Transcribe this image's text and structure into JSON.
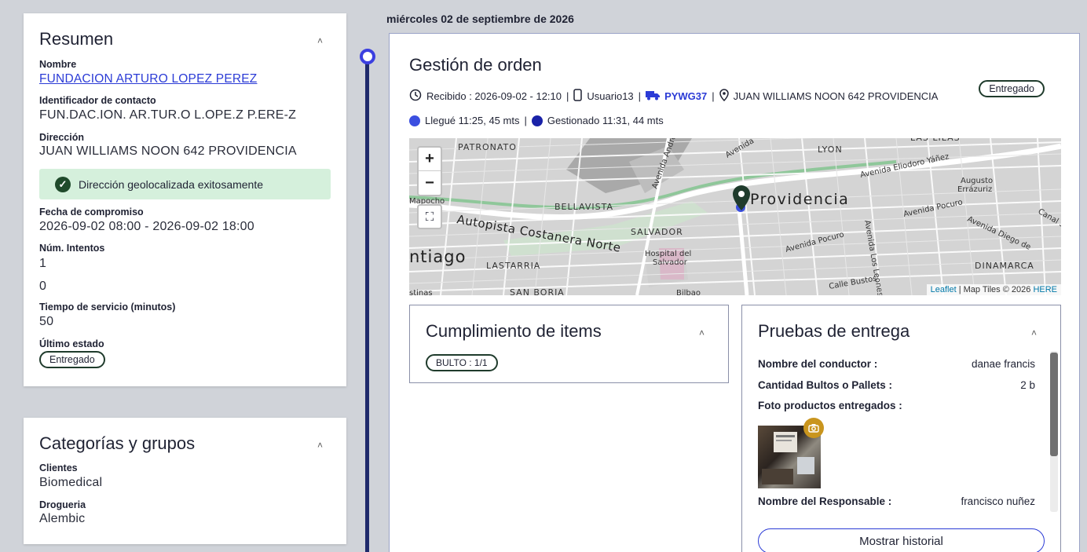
{
  "timeline": {
    "date": "miércoles 02 de septiembre de 2026"
  },
  "resumen": {
    "title": "Resumen",
    "name_label": "Nombre",
    "name_value": "FUNDACION ARTURO LOPEZ PEREZ",
    "contact_label": "Identificador de contacto",
    "contact_value": "FUN.DAC.ION. AR.TUR.O L.OPE.Z P.ERE-Z",
    "address_label": "Dirección",
    "address_value": "JUAN WILLIAMS NOON 642 PROVIDENCIA",
    "geo_message": "Dirección geolocalizada exitosamente",
    "commit_label": "Fecha de compromiso",
    "commit_value": "2026-09-02 08:00 - 2026-09-02 18:00",
    "attempts_label": "Núm. Intentos",
    "attempts_value": "1",
    "extra_value": "0",
    "service_label": "Tiempo de servicio (minutos)",
    "service_value": "50",
    "last_state_label": "Último estado",
    "last_state_value": "Entregado"
  },
  "categorias": {
    "title": "Categorías y grupos",
    "clients_label": "Clientes",
    "clients_value": "Biomedical",
    "drug_label": "Drogueria",
    "drug_value": "Alembic"
  },
  "orden": {
    "title": "Gestión de orden",
    "status": "Entregado",
    "received": "Recibido : 2026-09-02 - 12:10",
    "user": "Usuario13",
    "plate": "PYWG37",
    "address": "JUAN WILLIAMS NOON 642 PROVIDENCIA",
    "arrived": "Llegué 11:25, 45 mts",
    "managed": "Gestionado 11:31, 44 mts",
    "arrived_color": "#3b4fe0",
    "managed_color": "#1a22a8"
  },
  "map": {
    "zoom_in": "+",
    "zoom_out": "−",
    "labels": [
      "PATRONATO",
      "LYON",
      "LAS LILAS",
      "Providencia",
      "Avenida Eliodoro Yáñez",
      "Augusto Errázuriz",
      "BELLAVISTA",
      "Autopista Costanera Norte",
      "SALVADOR",
      "Hospital del Salvador",
      "Avenida Pocuro",
      "DINAMARCA",
      "ntiago",
      "LASTARRIA",
      "SAN BORJA",
      "Calle Bustos",
      "Avenida Los Leones",
      "Canal San Carlos",
      "Avenida Diego de",
      "Mapocho",
      "Avenida Andrés",
      "Avenida",
      "Bilbao",
      "stinas"
    ],
    "attribution_leaflet": "Leaflet",
    "attribution_rest": "| Map Tiles © 2026",
    "attribution_here": "HERE"
  },
  "items": {
    "title": "Cumplimiento de items",
    "badge": "BULTO : 1/1"
  },
  "pruebas": {
    "title": "Pruebas de entrega",
    "rows": [
      {
        "k": "Nombre del conductor :",
        "v": "danae francis"
      },
      {
        "k": "Cantidad Bultos o Pallets :",
        "v": "2 b"
      },
      {
        "k": "Foto productos entregados :",
        "v": ""
      },
      {
        "k": "Nombre del Responsable :",
        "v": "francisco nuñez"
      }
    ],
    "history_button": "Mostrar historial"
  }
}
